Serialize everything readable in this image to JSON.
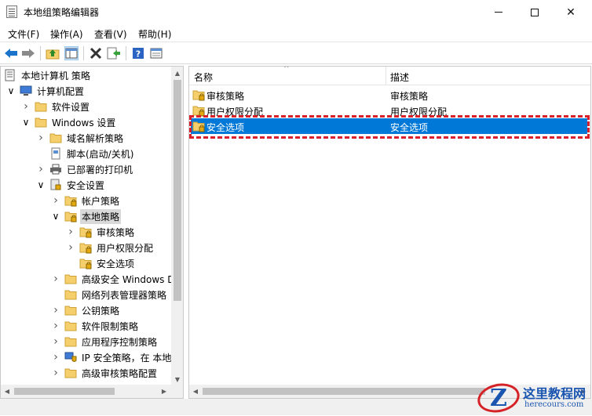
{
  "window": {
    "title": "本地组策略编辑器",
    "min_glyph": "—",
    "max_glyph": "□",
    "close_glyph": "✕"
  },
  "menu": [
    "文件(F)",
    "操作(A)",
    "查看(V)",
    "帮助(H)"
  ],
  "toolbar": {
    "icons": [
      "back-arrow-icon",
      "forward-arrow-icon",
      "up-folder-icon",
      "show-hide-tree-icon",
      "delete-icon",
      "export-list-icon",
      "help-icon",
      "properties-pane-icon"
    ]
  },
  "tree": [
    {
      "label": "本地计算机 策略",
      "level": 0,
      "expander": "",
      "icon": "computer-policy-icon"
    },
    {
      "label": "计算机配置",
      "level": 1,
      "expander": "open",
      "icon": "computer-icon"
    },
    {
      "label": "软件设置",
      "level": 2,
      "expander": "closed",
      "icon": "folder-icon"
    },
    {
      "label": "Windows 设置",
      "level": 2,
      "expander": "open",
      "icon": "folder-icon"
    },
    {
      "label": "域名解析策略",
      "level": 3,
      "expander": "closed",
      "icon": "folder-icon"
    },
    {
      "label": "脚本(启动/关机)",
      "level": 3,
      "expander": "",
      "icon": "script-icon"
    },
    {
      "label": "已部署的打印机",
      "level": 3,
      "expander": "closed",
      "icon": "printer-icon"
    },
    {
      "label": "安全设置",
      "level": 3,
      "expander": "open",
      "icon": "security-settings-icon"
    },
    {
      "label": "帐户策略",
      "level": 4,
      "expander": "closed",
      "icon": "lock-folder-icon"
    },
    {
      "label": "本地策略",
      "level": 4,
      "expander": "open",
      "icon": "lock-folder-icon",
      "selected": true
    },
    {
      "label": "审核策略",
      "level": 5,
      "expander": "closed",
      "icon": "lock-folder-icon"
    },
    {
      "label": "用户权限分配",
      "level": 5,
      "expander": "closed",
      "icon": "lock-folder-icon"
    },
    {
      "label": "安全选项",
      "level": 5,
      "expander": "",
      "icon": "lock-folder-icon"
    },
    {
      "label": "高级安全 Windows D",
      "level": 4,
      "expander": "closed",
      "icon": "folder-icon"
    },
    {
      "label": "网络列表管理器策略",
      "level": 4,
      "expander": "",
      "icon": "folder-icon"
    },
    {
      "label": "公钥策略",
      "level": 4,
      "expander": "closed",
      "icon": "folder-icon"
    },
    {
      "label": "软件限制策略",
      "level": 4,
      "expander": "closed",
      "icon": "folder-icon"
    },
    {
      "label": "应用程序控制策略",
      "level": 4,
      "expander": "closed",
      "icon": "folder-icon"
    },
    {
      "label": "IP 安全策略，在 本地",
      "level": 4,
      "expander": "closed",
      "icon": "ip-security-icon"
    },
    {
      "label": "高级审核策略配置",
      "level": 4,
      "expander": "closed",
      "icon": "folder-icon"
    }
  ],
  "list": {
    "headers": {
      "name": "名称",
      "desc": "描述"
    },
    "rows": [
      {
        "name": "审核策略",
        "desc": "审核策略",
        "icon": "lock-folder-icon"
      },
      {
        "name": "用户权限分配",
        "desc": "用户权限分配",
        "icon": "lock-folder-icon"
      },
      {
        "name": "安全选项",
        "desc": "安全选项",
        "icon": "lock-folder-icon",
        "selected": true
      }
    ]
  },
  "watermark": {
    "z": "Z",
    "cn": "这里教程网",
    "url": "herecours.com"
  }
}
